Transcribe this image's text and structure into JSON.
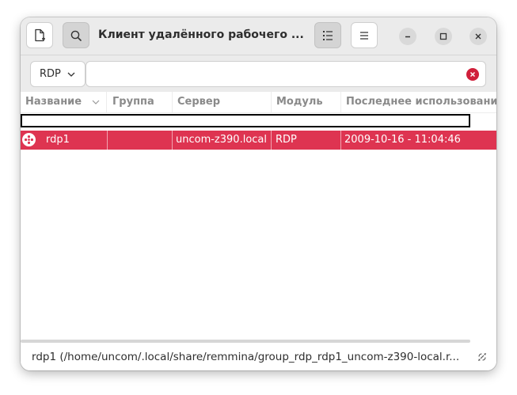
{
  "window": {
    "title": "Клиент удалённого рабочего ..."
  },
  "headerbar": {
    "icons": [
      "new-connection-icon",
      "search-icon",
      "list-view-icon",
      "hamburger-menu-icon",
      "minimize-icon",
      "maximize-icon",
      "close-icon"
    ]
  },
  "toolbar": {
    "protocol": "RDP",
    "search_value": "",
    "search_placeholder": ""
  },
  "table": {
    "columns": [
      "Название",
      "Группа",
      "Сервер",
      "Модуль",
      "Последнее использование"
    ],
    "rows": [
      {
        "name": "rdp1",
        "group": "",
        "server": "uncom-z390.local",
        "plugin": "RDP",
        "last_used": "2009-10-16 - 11:04:46"
      }
    ]
  },
  "statusbar": {
    "text": "rdp1 (/home/uncom/.local/share/remmina/group_rdp_rdp1_uncom-z390-local.r..."
  },
  "colors": {
    "accent": "#de3451",
    "headerbar": "#ebebeb",
    "clear_button": "#d01f3a"
  }
}
